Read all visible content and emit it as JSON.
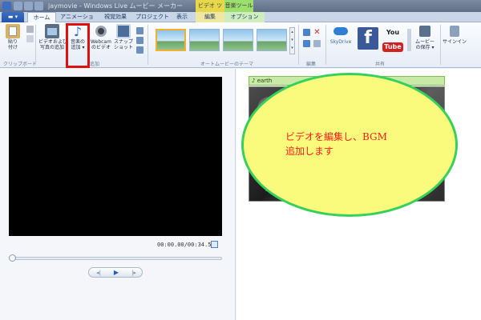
{
  "window": {
    "title": "jaymovie - Windows Live ムービー メーカー",
    "context_video_label": "ビデオ ツール",
    "context_music_label": "音楽ツール"
  },
  "tabs": [
    {
      "label": "",
      "kind": "file-menu"
    },
    {
      "label": "ホーム",
      "active": true
    },
    {
      "label": "アニメーション"
    },
    {
      "label": "視覚効果"
    },
    {
      "label": "プロジェクト"
    },
    {
      "label": "表示"
    },
    {
      "label": "編集"
    },
    {
      "label": "オプション"
    }
  ],
  "ribbon": {
    "clipboard": {
      "paste_label_1": "貼り",
      "paste_label_2": "付け",
      "group_label": "クリップボード"
    },
    "add": {
      "video_photo_label_1": "ビデオおよび",
      "video_photo_label_2": "写真の追加",
      "music_label_1": "音楽の",
      "music_label_2": "追加 ▾",
      "webcam_label_1": "Webcam",
      "webcam_label_2": "のビデオ",
      "snapshot_label_1": "スナップ",
      "snapshot_label_2": "ショット",
      "group_label": "追加"
    },
    "themes": {
      "group_label": "オートムービーのテーマ"
    },
    "edit": {
      "group_label": "編集"
    },
    "share": {
      "skydrive_label": "SkyDrive",
      "facebook_glyph": "f",
      "youtube_you": "You",
      "youtube_tube": "Tube",
      "save_label_1": "ムービー",
      "save_label_2": "の保存 ▾",
      "group_label": "共有"
    },
    "signin": {
      "label": "サインイン"
    }
  },
  "preview": {
    "timecode": "00:00.00/00:34.50",
    "prev_frame": "◂|",
    "play": "▶",
    "next_frame": "|▸"
  },
  "storyboard": {
    "music_track": "♪ earth"
  },
  "annotation": {
    "line1": "ビデオを編集し、BGM",
    "line2": "追加します"
  },
  "colors": {
    "highlight_box": "#e01010",
    "bubble_fill": "#fafb7d",
    "bubble_border": "#35d15a",
    "annotation_text": "#ff1a1a",
    "music_track": "#c8eaa6"
  }
}
